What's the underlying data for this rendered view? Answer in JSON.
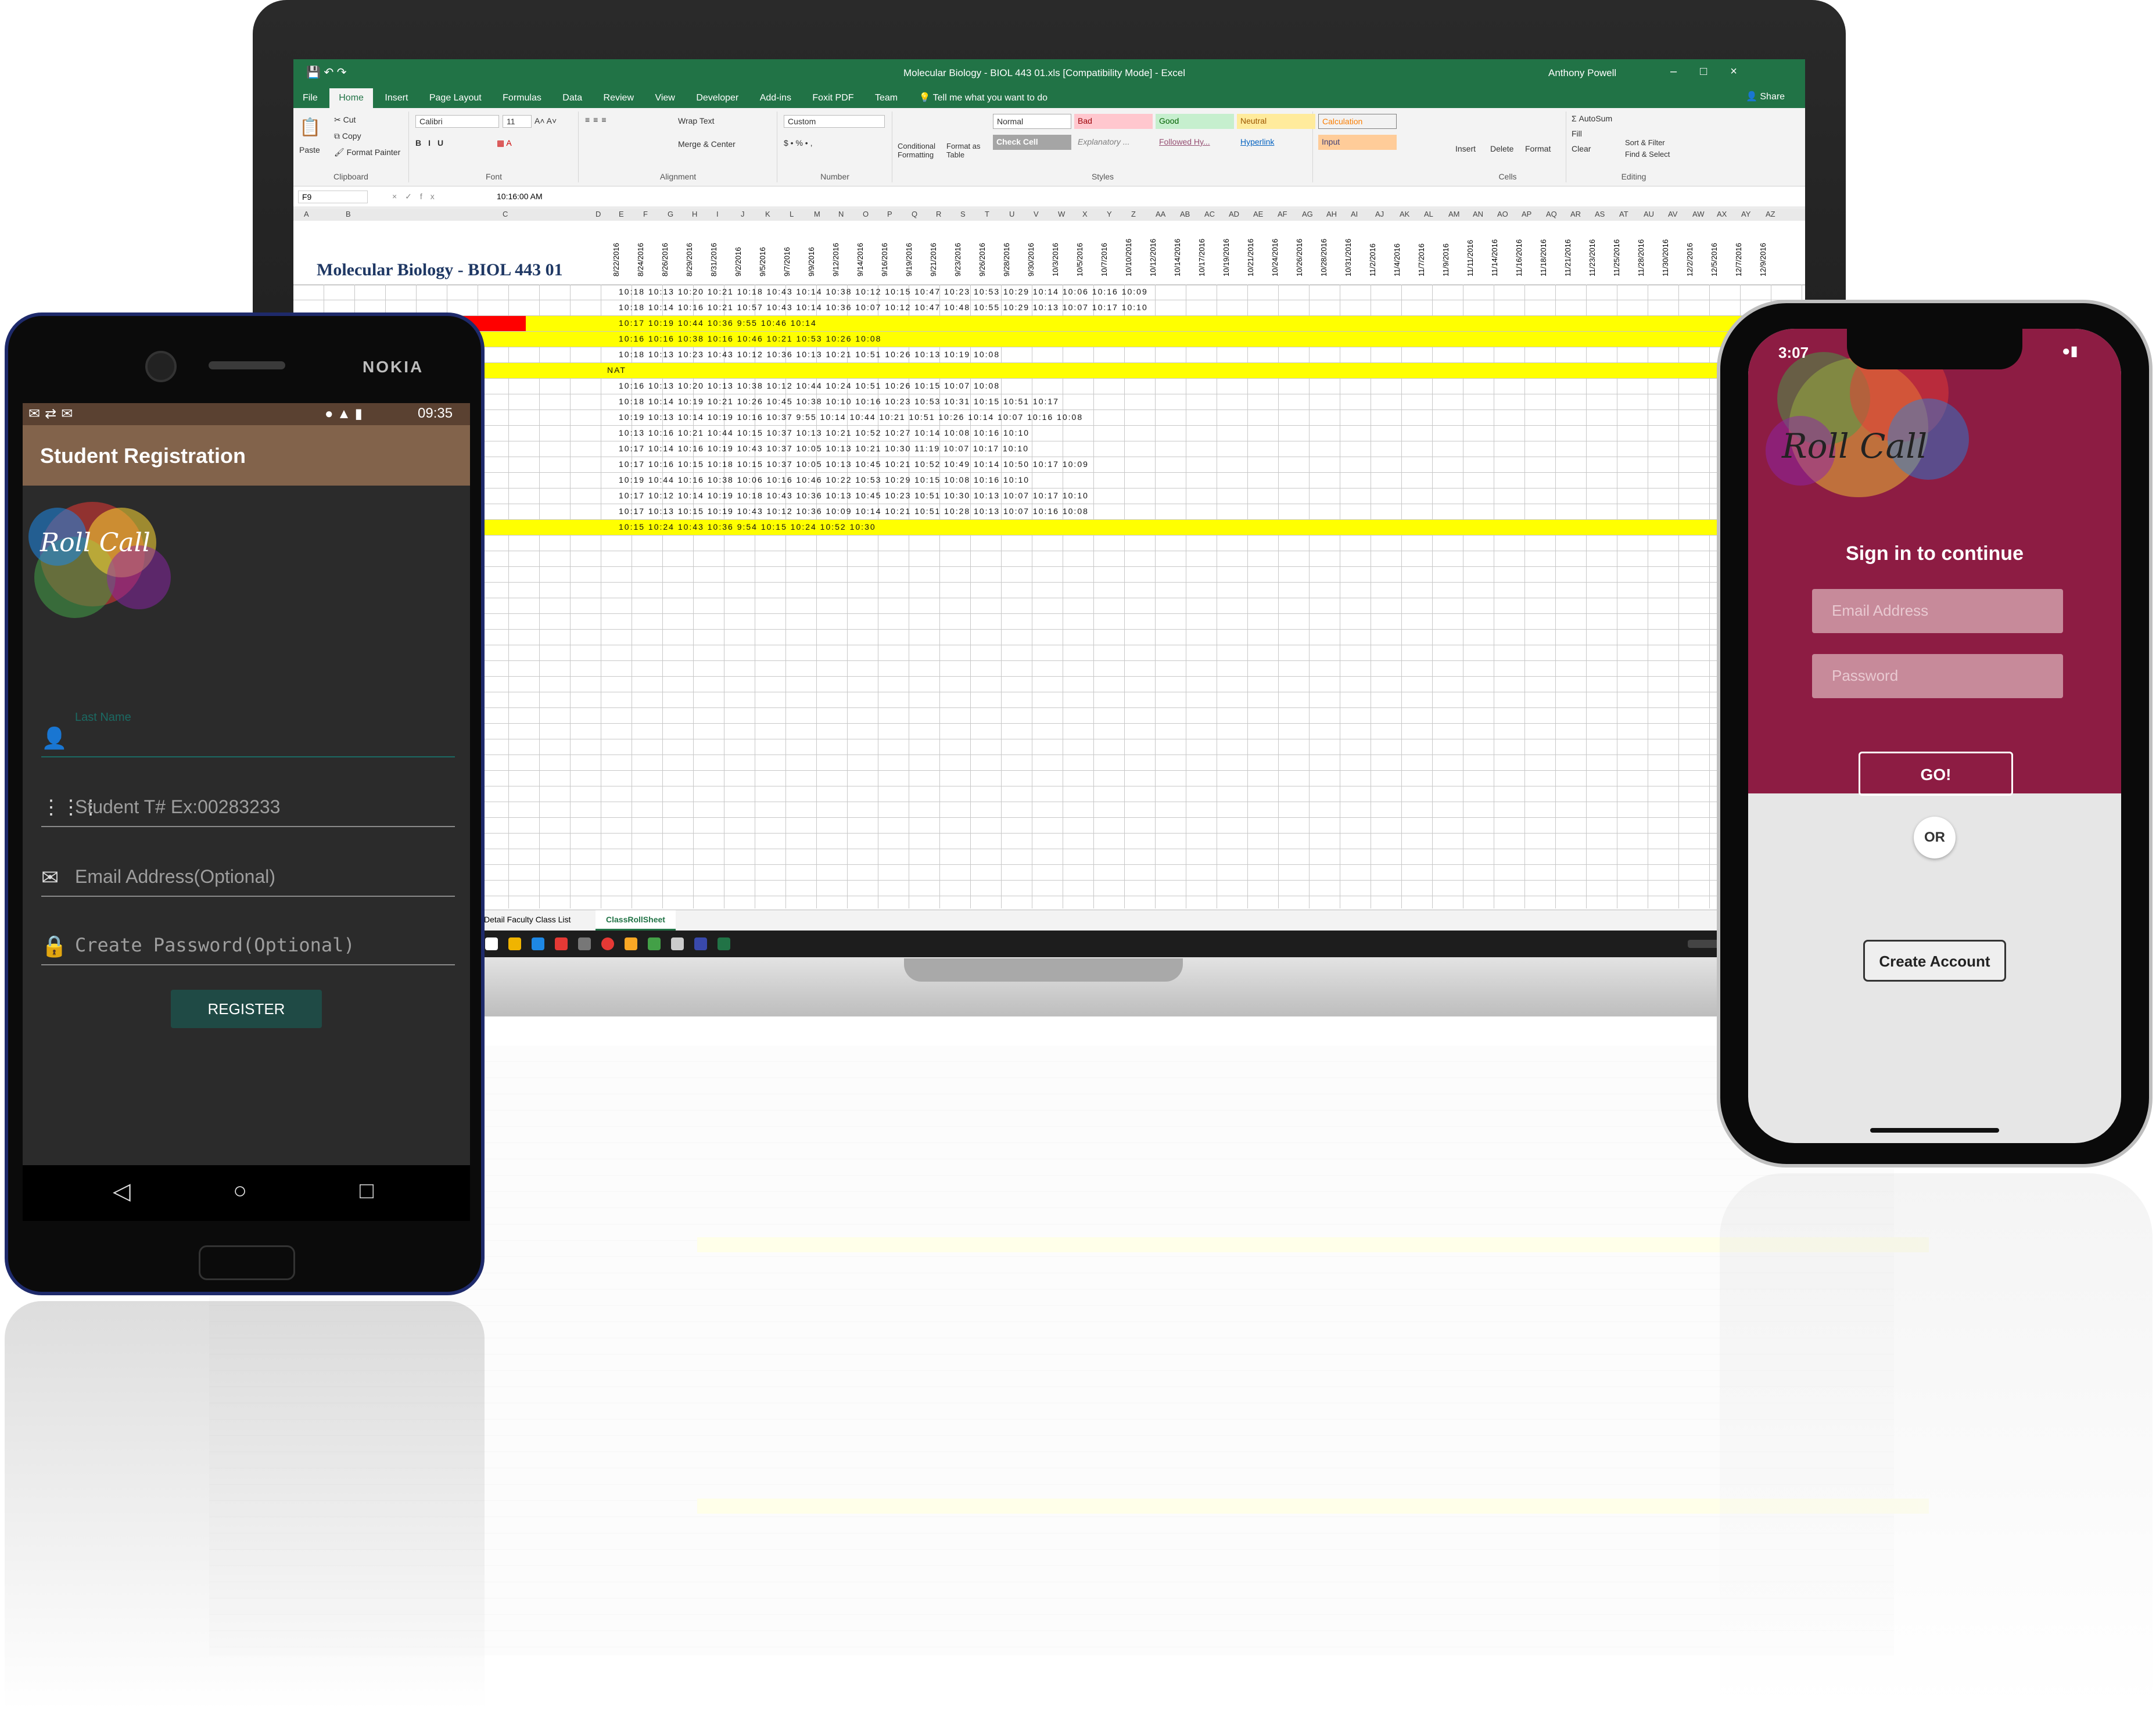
{
  "excel": {
    "window_title": "Molecular Biology - BIOL 443 01.xls [Compatibility Mode] - Excel",
    "user": "Anthony Powell",
    "tabs": [
      "File",
      "Home",
      "Insert",
      "Page Layout",
      "Formulas",
      "Data",
      "Review",
      "View",
      "Developer",
      "Add-ins",
      "Foxit PDF",
      "Team"
    ],
    "tell_me": "Tell me what you want to do",
    "share": "Share",
    "clipboard": {
      "paste": "Paste",
      "cut": "Cut",
      "copy": "Copy",
      "format_painter": "Format Painter",
      "label": "Clipboard"
    },
    "font": {
      "name": "Calibri",
      "size": "11",
      "label": "Font"
    },
    "alignment": {
      "wrap": "Wrap Text",
      "merge": "Merge & Center",
      "label": "Alignment"
    },
    "number": {
      "format": "Custom",
      "label": "Number"
    },
    "styles": {
      "conditional": "Conditional Formatting",
      "format_table": "Format as Table",
      "normal": "Normal",
      "bad": "Bad",
      "good": "Good",
      "neutral": "Neutral",
      "calculation": "Calculation",
      "check_cell": "Check Cell",
      "explanatory": "Explanatory ...",
      "followed": "Followed Hy...",
      "hyperlink": "Hyperlink",
      "input": "Input",
      "label": "Styles"
    },
    "cells": {
      "insert": "Insert",
      "delete": "Delete",
      "format": "Format",
      "label": "Cells"
    },
    "editing": {
      "autosum": "AutoSum",
      "fill": "Fill",
      "clear": "Clear",
      "sort": "Sort & Filter",
      "find": "Find & Select",
      "label": "Editing"
    },
    "name_box": "F9",
    "formula": "10:16:00 AM",
    "columns": [
      "A",
      "B",
      "C",
      "D",
      "E",
      "F",
      "G",
      "H",
      "I",
      "J",
      "K",
      "L",
      "M",
      "N",
      "O",
      "P",
      "Q",
      "R",
      "S",
      "T",
      "U",
      "V",
      "W",
      "X",
      "Y",
      "Z",
      "AA",
      "AB",
      "AC",
      "AD",
      "AE",
      "AF",
      "AG",
      "AH",
      "AI",
      "AJ",
      "AK",
      "AL",
      "AM",
      "AN",
      "AO",
      "AP",
      "AQ",
      "AR",
      "AS",
      "AT",
      "AU",
      "AV",
      "AW",
      "AX",
      "AY",
      "AZ"
    ],
    "dates": [
      "8/22/2016",
      "8/24/2016",
      "8/26/2016",
      "8/29/2016",
      "8/31/2016",
      "9/2/2016",
      "9/5/2016",
      "9/7/2016",
      "9/9/2016",
      "9/12/2016",
      "9/14/2016",
      "9/16/2016",
      "9/19/2016",
      "9/21/2016",
      "9/23/2016",
      "9/26/2016",
      "9/28/2016",
      "9/30/2016",
      "10/3/2016",
      "10/5/2016",
      "10/7/2016",
      "10/10/2016",
      "10/12/2016",
      "10/14/2016",
      "10/17/2016",
      "10/19/2016",
      "10/21/2016",
      "10/24/2016",
      "10/26/2016",
      "10/28/2016",
      "10/31/2016",
      "11/2/2016",
      "11/4/2016",
      "11/7/2016",
      "11/9/2016",
      "11/11/2016",
      "11/14/2016",
      "11/16/2016",
      "11/18/2016",
      "11/21/2016",
      "11/23/2016",
      "11/25/2016",
      "11/28/2016",
      "11/30/2016",
      "12/2/2016",
      "12/5/2016",
      "12/7/2016",
      "12/9/2016"
    ],
    "sheet_title": "Molecular Biology - BIOL 443 01",
    "nat_label": "NAT",
    "sheet_tabs": [
      "Detail Faculty Class List",
      "ClassRollSheet"
    ],
    "time_rows": [
      "10:18 10:13 10:20 10:21 10:18   10:43   10:14 10:38   10:12 10:15 10:47 10:23   10:53 10:29 10:14 10:06 10:16 10:09",
      "10:18 10:14 10:16 10:21 10:57   10:43   10:14 10:36   10:07 10:12 10:47 10:48   10:55 10:29 10:13 10:07 10:17 10:10",
      "10:17   10:19   10:44   10:36   9:55   10:46   10:14",
      "10:16   10:16 10:38   10:16 10:46 10:21   10:53 10:26   10:08",
      "10:18 10:13   10:23   10:43   10:12 10:36   10:13   10:21   10:51 10:26 10:13 10:19   10:08",
      "",
      "10:16 10:13   10:20   10:13 10:38   10:12 10:44 10:24   10:51 10:26 10:15 10:07   10:08",
      "10:18 10:14 10:19 10:21 10:26   10:45   10:38   10:10 10:16   10:23   10:53 10:31 10:15 10:51 10:17",
      "10:19 10:13 10:14 10:19   10:16 10:37   9:55 10:14 10:44 10:21   10:51 10:26 10:14 10:07 10:16 10:08",
      "10:13 10:16 10:21   10:44   10:15 10:37   10:13   10:21   10:52 10:27 10:14 10:08 10:16 10:10",
      "10:17 10:14 10:16 10:19   10:43   10:37   10:05 10:13   10:21   10:30 11:19 10:07 10:17 10:10",
      "10:17 10:16 10:15   10:18   10:15 10:37   10:05 10:13 10:45 10:21   10:52 10:49 10:14 10:50 10:17 10:09",
      "10:19   10:44   10:16 10:38   10:06 10:16 10:46 10:22   10:53 10:29 10:15 10:08 10:16 10:10",
      "10:17 10:12 10:14 10:19 10:18   10:43   10:36   10:13 10:45 10:23   10:51 10:30 10:13 10:07 10:17 10:10",
      "10:17 10:13 10:15 10:19   10:43   10:12 10:36   10:09 10:14   10:21   10:51 10:28 10:13 10:07 10:16 10:08",
      "10:15 10:24   10:43   10:36   9:54 10:15   10:24   10:52 10:30"
    ]
  },
  "android": {
    "brand": "NOKIA",
    "status_time": "09:35",
    "title": "Student Registration",
    "logo_text": "Roll Call",
    "last_name_label": "Last Name",
    "student_placeholder": "Student T# Ex:00283233",
    "email_placeholder": "Email Address(Optional)",
    "password_placeholder": "Create Password(Optional)",
    "register_button": "REGISTER"
  },
  "iphone": {
    "time": "3:07",
    "logo_text": "Roll Call",
    "heading": "Sign in to continue",
    "email_placeholder": "Email Address",
    "password_placeholder": "Password",
    "go_button": "GO!",
    "or_label": "OR",
    "create_account": "Create Account"
  },
  "colors": {
    "excel_green": "#217346",
    "highlight_yellow": "#ffff00",
    "android_header": "#82634b",
    "android_button": "#1f4a45",
    "iphone_accent": "#8d1c43"
  }
}
